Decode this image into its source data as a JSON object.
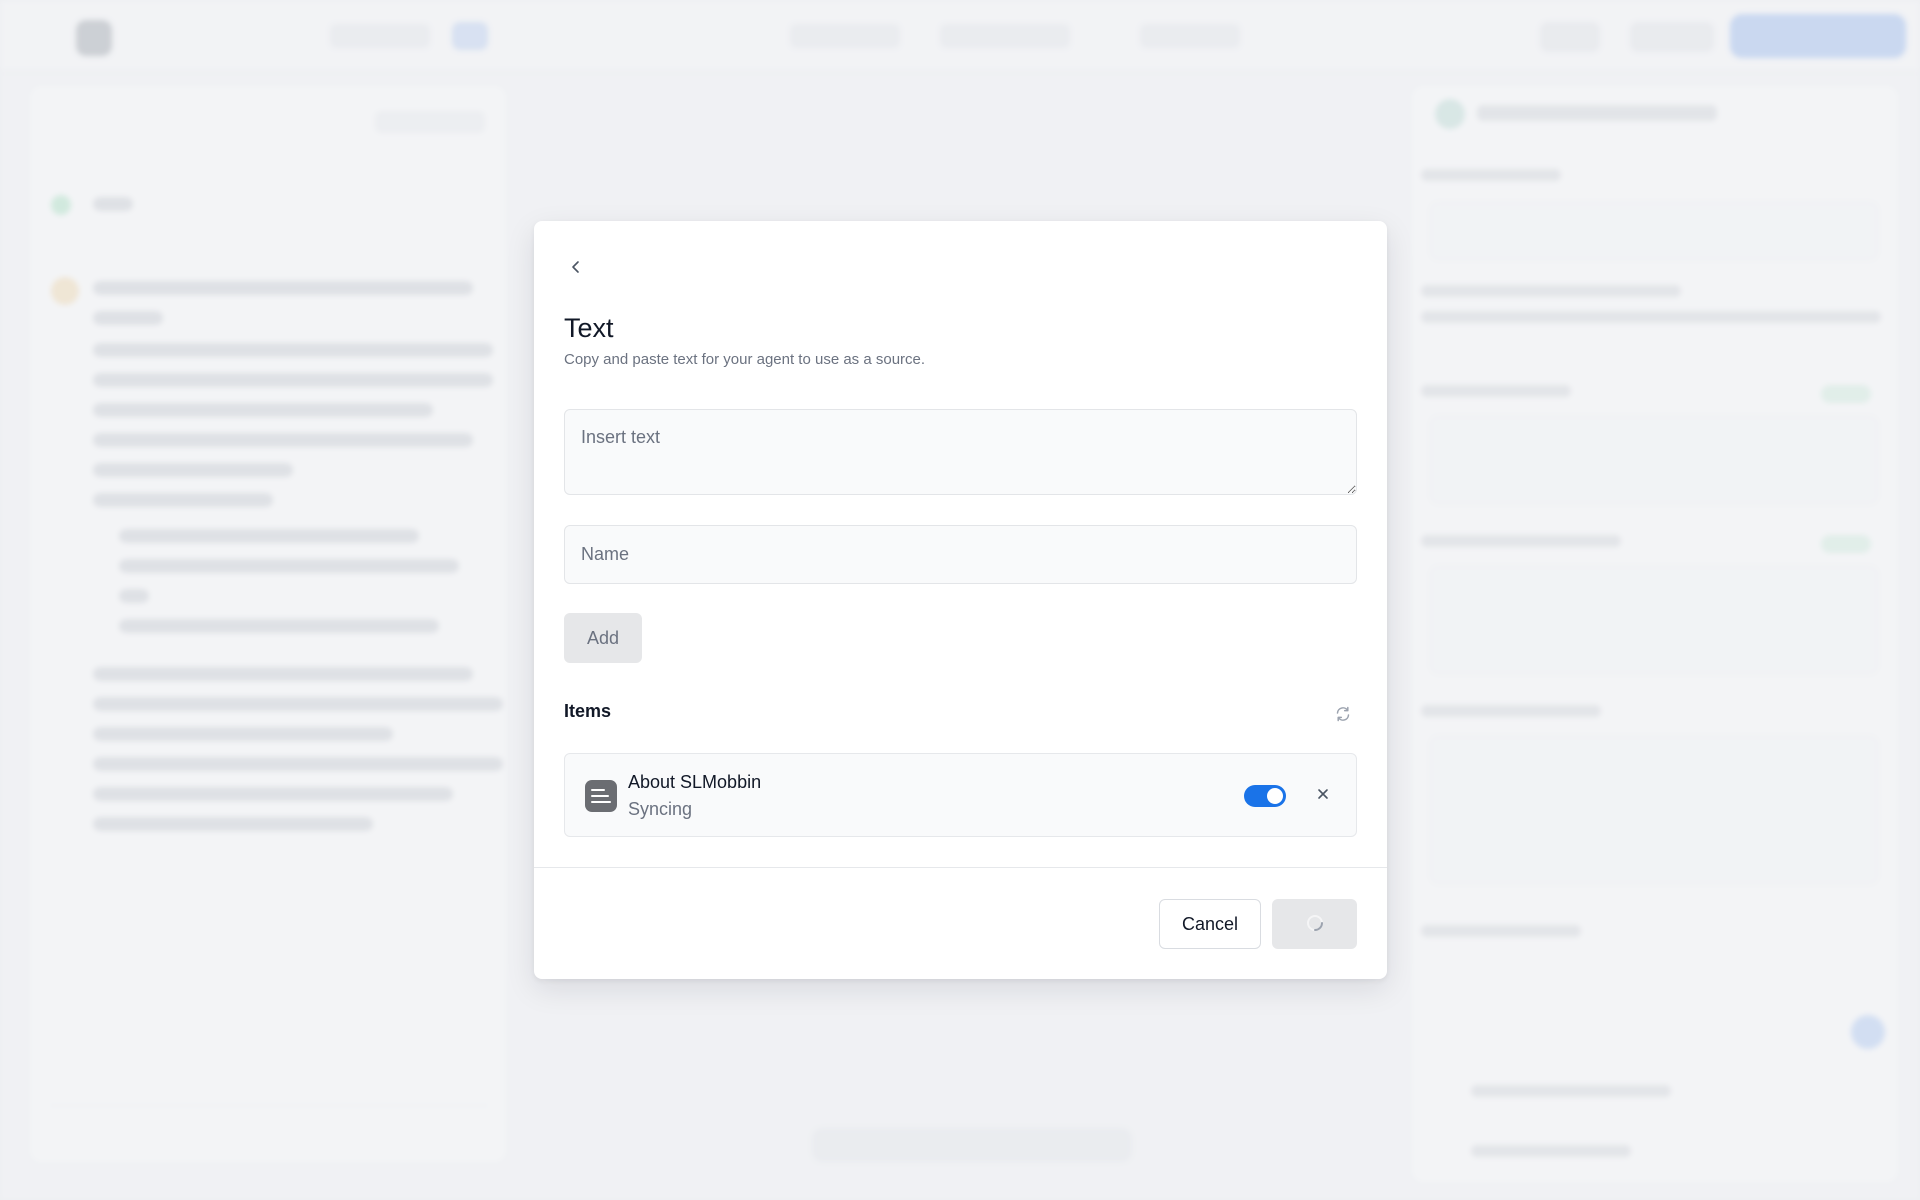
{
  "modal": {
    "title": "Text",
    "subtitle": "Copy and paste text for your agent to use as a source.",
    "text_placeholder": "Insert text",
    "name_placeholder": "Name",
    "add_label": "Add",
    "items_label": "Items",
    "items": [
      {
        "name": "About SLMobbin",
        "status": "Syncing",
        "enabled": true,
        "icon": "text-document-icon"
      }
    ],
    "cancel_label": "Cancel",
    "submit_state": "loading"
  },
  "icons": {
    "back": "chevron-left-icon",
    "refresh": "refresh-icon",
    "remove": "close-icon",
    "spinner": "spinner-icon"
  },
  "colors": {
    "accent": "#1a73e8",
    "disabled_button_bg": "#e6e7e9",
    "muted_text": "#6b7280",
    "overlay": "#eceef1"
  }
}
